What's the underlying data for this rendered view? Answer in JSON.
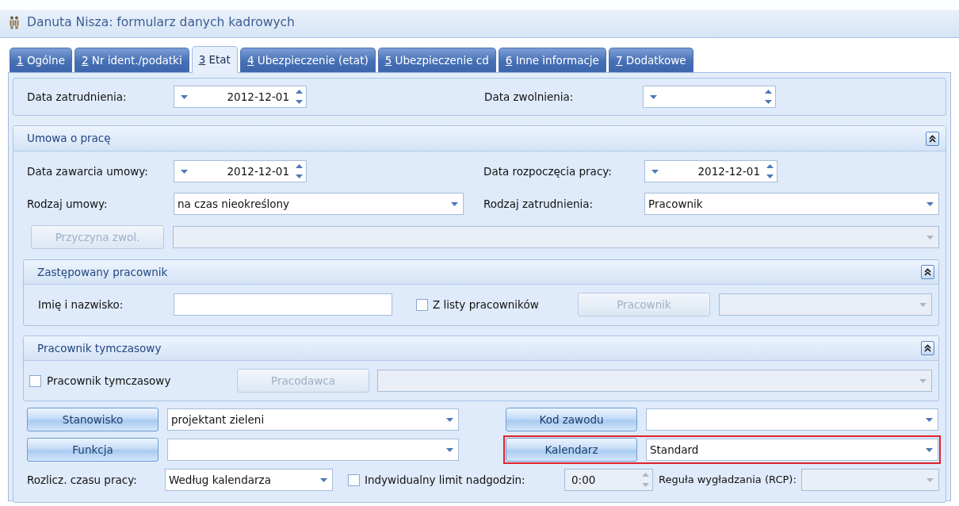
{
  "window": {
    "title": "Danuta Nisza: formularz danych kadrowych"
  },
  "tabs": [
    {
      "key": "1",
      "label": "Ogólne",
      "selected": false
    },
    {
      "key": "2",
      "label": "Nr ident./podatki",
      "selected": false
    },
    {
      "key": "3",
      "label": "Etat",
      "selected": true
    },
    {
      "key": "4",
      "label": "Ubezpieczenie (etat)",
      "selected": false
    },
    {
      "key": "5",
      "label": "Ubezpieczenie cd",
      "selected": false
    },
    {
      "key": "6",
      "label": "Inne informacje",
      "selected": false
    },
    {
      "key": "7",
      "label": "Dodatkowe",
      "selected": false
    }
  ],
  "employment_dates": [
    {
      "label": "Data zatrudnienia:",
      "value": "2012-12-01"
    },
    {
      "label": "Data zwolnienia:"
    }
  ],
  "contract": {
    "title": "Umowa o pracę",
    "contract_dates": [
      {
        "label": "Data zawarcia umowy:",
        "value": "2012-12-01"
      },
      {
        "label": "Data rozpoczęcia pracy:",
        "value": "2012-12-01"
      }
    ],
    "types": [
      {
        "label": "Rodzaj umowy:",
        "value": "na czas nieokreślony"
      },
      {
        "label": "Rodzaj zatrudnienia:",
        "value": "Pracownik"
      }
    ],
    "termination_button": {
      "label": "Przyczyna zwol.",
      "disabled": true
    },
    "replaced_employee": {
      "title": "Zastępowany pracownik",
      "name_label": "Imię i nazwisko:",
      "from_list": {
        "label": "Z listy pracowników",
        "checked": false
      },
      "employee_button": {
        "label": "Pracownik",
        "disabled": true
      }
    },
    "temporary_worker": {
      "title": "Pracownik tymczasowy",
      "checkbox": {
        "label": "Pracownik tymczasowy",
        "checked": false
      },
      "employer_button": {
        "label": "Pracodawca",
        "disabled": true
      }
    },
    "pickers": [
      {
        "button": "Stanowisko",
        "value": "projektant zieleni",
        "highlighted": false
      },
      {
        "button": "Kod zawodu",
        "highlighted": false
      },
      {
        "button": "Funkcja",
        "highlighted": false
      },
      {
        "button": "Kalendarz",
        "value": "Standard",
        "highlighted": true
      }
    ],
    "settlement": {
      "label": "Rozlicz. czasu pracy:",
      "value": "Według kalendarza"
    },
    "overtime": {
      "label": "Indywidualny limit nadgodzin:",
      "checked": false,
      "value": "0:00"
    },
    "smoothing": {
      "label": "Reguła wygładzania (RCP):"
    }
  }
}
